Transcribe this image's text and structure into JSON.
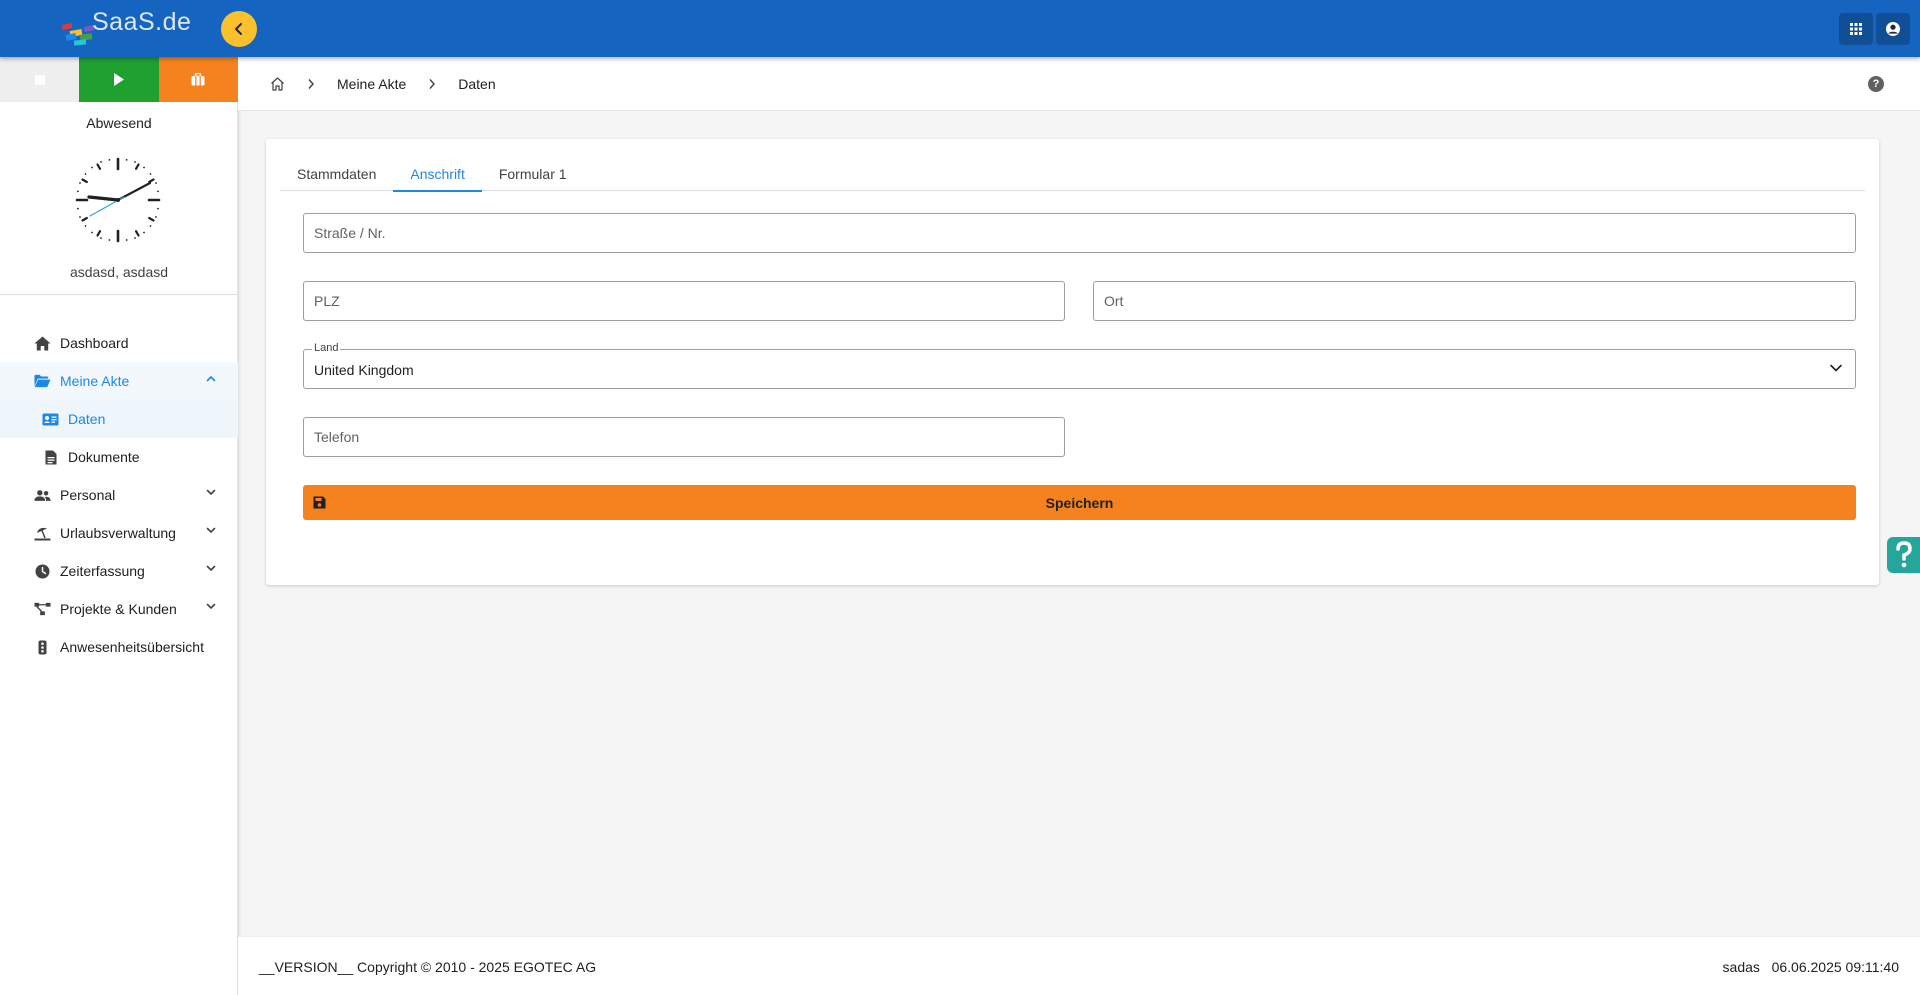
{
  "header": {
    "logo_text": "SaaS.de",
    "colors": {
      "bar": "#1565c0",
      "collapse": "#fbc02d"
    }
  },
  "sidebar": {
    "status_buttons": [
      {
        "name": "stop",
        "color": "#eeeeee",
        "icon": "stop-icon"
      },
      {
        "name": "start",
        "color": "#1fa02f",
        "icon": "play-icon"
      },
      {
        "name": "break",
        "color": "#f5821f",
        "icon": "briefcase-icon"
      }
    ],
    "status_label": "Abwesend",
    "user_name": "asdasd, asdasd",
    "items": [
      {
        "label": "Dashboard",
        "icon": "home-icon"
      },
      {
        "label": "Meine Akte",
        "icon": "folder-open-icon"
      },
      {
        "label": "Daten",
        "icon": "id-card-icon"
      },
      {
        "label": "Dokumente",
        "icon": "file-icon"
      },
      {
        "label": "Personal",
        "icon": "users-icon"
      },
      {
        "label": "Urlaubsverwaltung",
        "icon": "beach-umbrella-icon"
      },
      {
        "label": "Zeiterfassung",
        "icon": "clock-icon"
      },
      {
        "label": "Projekte & Kunden",
        "icon": "project-diagram-icon"
      },
      {
        "label": "Anwesenheitsübersicht",
        "icon": "traffic-light-icon"
      }
    ]
  },
  "breadcrumb": {
    "items": [
      "Meine Akte",
      "Daten"
    ]
  },
  "tabs": [
    {
      "label": "Stammdaten"
    },
    {
      "label": "Anschrift"
    },
    {
      "label": "Formular 1"
    }
  ],
  "form": {
    "street": {
      "placeholder": "Straße / Nr.",
      "value": ""
    },
    "zip": {
      "placeholder": "PLZ",
      "value": ""
    },
    "city": {
      "placeholder": "Ort",
      "value": ""
    },
    "country": {
      "label": "Land",
      "value": "United Kingdom"
    },
    "phone": {
      "placeholder": "Telefon",
      "value": ""
    },
    "save_label": "Speichern",
    "save_color": "#f5821f"
  },
  "footer": {
    "copyright": "__VERSION__ Copyright © 2010 - 2025 EGOTEC AG",
    "user": "sadas",
    "datetime": "06.06.2025 09:11:40"
  }
}
